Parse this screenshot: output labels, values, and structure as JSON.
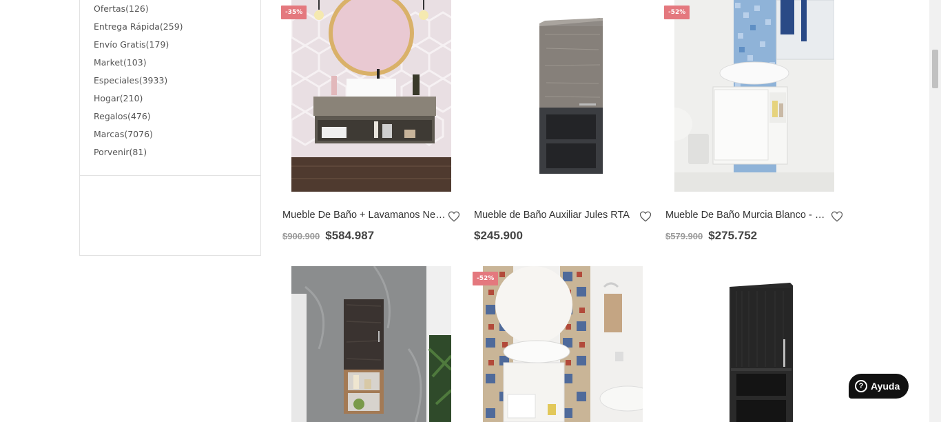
{
  "sidebar": {
    "categories": [
      {
        "label": "Ofertas(126)"
      },
      {
        "label": "Entrega Rápida(259)"
      },
      {
        "label": "Envío Gratis(179)"
      },
      {
        "label": "Market(103)"
      },
      {
        "label": "Especiales(3933)"
      },
      {
        "label": "Hogar(210)"
      },
      {
        "label": "Regalos(476)"
      },
      {
        "label": "Marcas(7076)"
      },
      {
        "label": "Porvenir(81)"
      }
    ]
  },
  "products": [
    {
      "badge": "-35%",
      "title": "Mueble De Baño + Lavamanos Nelson",
      "old_price": "$900.900",
      "price": "$584.987"
    },
    {
      "badge": "",
      "title": "Mueble de Baño Auxiliar Jules RTA",
      "old_price": "",
      "price": "$245.900"
    },
    {
      "badge": "-52%",
      "title": "Mueble De Baño Murcia Blanco - RTA",
      "old_price": "$579.900",
      "price": "$275.752"
    },
    {
      "badge": "",
      "title": "",
      "old_price": "",
      "price": ""
    },
    {
      "badge": "-52%",
      "title": "",
      "old_price": "",
      "price": ""
    },
    {
      "badge": "",
      "title": "",
      "old_price": "",
      "price": ""
    }
  ],
  "help": {
    "label": "Ayuda",
    "icon": "question-icon"
  },
  "colors": {
    "badge": "#e4787e",
    "help_bg": "#111111",
    "heart": "#555555"
  }
}
